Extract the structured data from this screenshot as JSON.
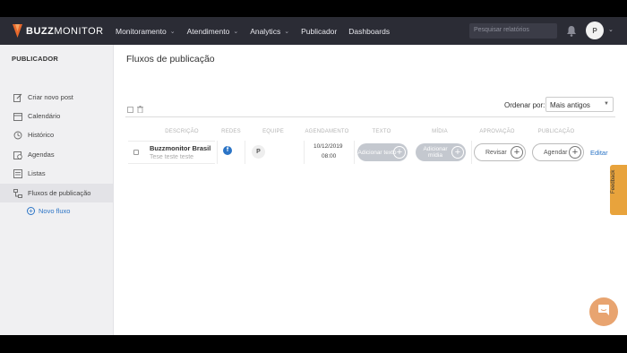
{
  "nav": {
    "brand_bold": "BUZZ",
    "brand_rest": "MONITOR",
    "items": [
      {
        "label": "Monitoramento",
        "dropdown": true
      },
      {
        "label": "Atendimento",
        "dropdown": true
      },
      {
        "label": "Analytics",
        "dropdown": true
      },
      {
        "label": "Publicador",
        "dropdown": false
      },
      {
        "label": "Dashboards",
        "dropdown": false
      }
    ],
    "search_placeholder": "Pesquisar relatórios",
    "avatar_initial": "P"
  },
  "sidebar": {
    "title": "PUBLICADOR",
    "items": [
      {
        "label": "Criar novo post",
        "icon": "edit-icon"
      },
      {
        "label": "Calendário",
        "icon": "calendar-icon"
      },
      {
        "label": "Histórico",
        "icon": "history-icon"
      },
      {
        "label": "Agendas",
        "icon": "schedule-icon"
      },
      {
        "label": "Listas",
        "icon": "list-icon"
      },
      {
        "label": "Fluxos de publicação",
        "icon": "flow-icon",
        "active": true
      }
    ],
    "new_flow": "Novo fluxo"
  },
  "main": {
    "title": "Fluxos de publicação",
    "order_label": "Ordenar por:",
    "order_value": "Mais antigos",
    "columns": [
      "DESCRIÇÃO",
      "REDES",
      "EQUIPE",
      "AGENDAMENTO",
      "TEXTO",
      "MÍDIA",
      "APROVAÇÃO",
      "PUBLICAÇÃO"
    ],
    "rows": [
      {
        "title": "Buzzmonitor Brasil",
        "description": "Tese teste teste",
        "team": "P",
        "date": "10/12/2019",
        "time": "08:00",
        "text_action": "Adicionar texto",
        "media_action": "Adicionar mídia",
        "approval_action": "Revisar",
        "publish_action": "Agendar",
        "edit": "Editar"
      }
    ]
  },
  "feedback_label": "Feedback",
  "colors": {
    "nav_bg": "#2b2c35",
    "accent": "#2b74c6",
    "feedback": "#e8a33c",
    "chat": "#e8a470",
    "brand": "#e8692c"
  }
}
